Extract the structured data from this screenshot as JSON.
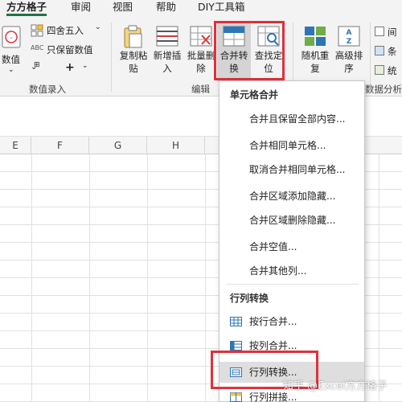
{
  "menu_tabs": [
    {
      "label": "方方格子",
      "active": true
    },
    {
      "label": "审阅"
    },
    {
      "label": "视图"
    },
    {
      "label": "帮助"
    },
    {
      "label": "DIY工具箱"
    }
  ],
  "ribbon": {
    "numeric_button": "数值",
    "round_button": "四舍五入",
    "keep_values_button": "只保留数值",
    "plus_button": "+",
    "copy_paste_button": [
      "复制粘",
      "贴"
    ],
    "add_insert_button": [
      "新增插",
      "入"
    ],
    "batch_delete_button": [
      "批量删",
      "除"
    ],
    "merge_convert_button": [
      "合并转",
      "换"
    ],
    "find_locate_button": [
      "查找定",
      "位"
    ],
    "random_repeat_button": [
      "随机重",
      "复"
    ],
    "advanced_sort_button": [
      "高级排",
      "序"
    ],
    "right_col_items": [
      "间",
      "条",
      "统"
    ],
    "groups": {
      "numeric_input": "数值录入",
      "edit": "编辑",
      "data_analysis": "数据分析"
    }
  },
  "columns": [
    "E",
    "F",
    "G",
    "H"
  ],
  "dropdown": {
    "section1_header": "单元格合并",
    "section1_items": [
      "合并且保留全部内容...",
      "合并相同单元格...",
      "取消合并相同单元格...",
      "合并区域添加隐藏...",
      "合并区域删除隐藏...",
      "合并空值...",
      "合并其他列..."
    ],
    "section2_header": "行列转换",
    "section2_items": [
      {
        "label": "按行合并...",
        "icon": "row-merge-icon"
      },
      {
        "label": "按列合并...",
        "icon": "column-merge-icon"
      },
      {
        "label": "行列转换...",
        "icon": "row-col-convert-icon"
      },
      {
        "label": "行列拼接...",
        "icon": "row-col-join-icon"
      }
    ]
  },
  "watermark": "知乎 @Excel方方格子",
  "colors": {
    "accent": "#217346",
    "highlight_box": "#e0303a",
    "icon_blue": "#2e75b6"
  }
}
